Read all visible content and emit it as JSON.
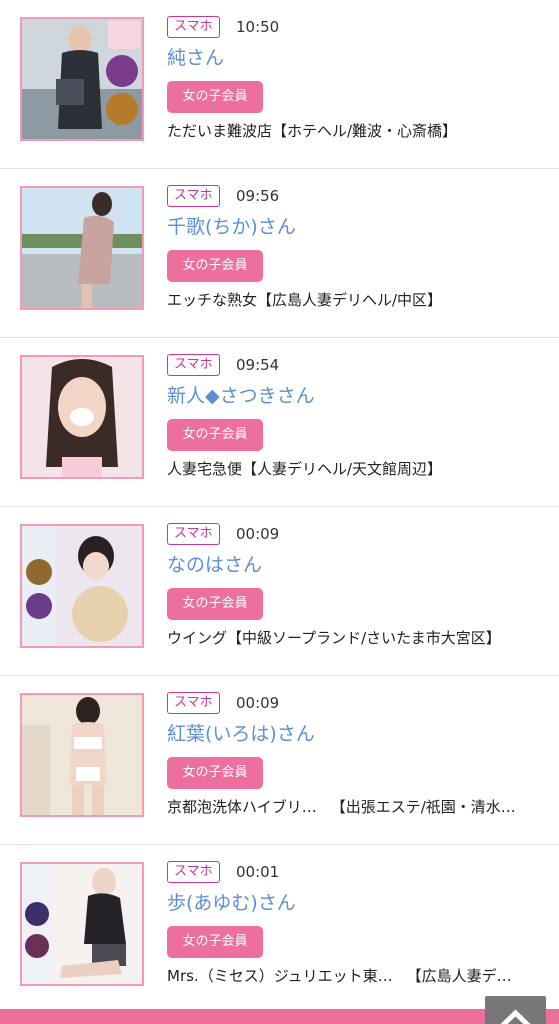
{
  "entries": [
    {
      "device": "スマホ",
      "time": "10:50",
      "name": "純さん",
      "badge": "女の子会員",
      "shop": "ただいま難波店【ホテヘル/難波・心斎橋】",
      "shop_extra": ""
    },
    {
      "device": "スマホ",
      "time": "09:56",
      "name": "千歌(ちか)さん",
      "badge": "女の子会員",
      "shop": "エッチな熟女【広島人妻デリヘル/中区】",
      "shop_extra": ""
    },
    {
      "device": "スマホ",
      "time": "09:54",
      "name": "新人◆さつきさん",
      "badge": "女の子会員",
      "shop": "人妻宅急便【人妻デリヘル/天文館周辺】",
      "shop_extra": ""
    },
    {
      "device": "スマホ",
      "time": "00:09",
      "name": "なのはさん",
      "badge": "女の子会員",
      "shop": "ウイング【中級ソープランド/さいたま市大宮区】",
      "shop_extra": ""
    },
    {
      "device": "スマホ",
      "time": "00:09",
      "name": "紅葉(いろは)さん",
      "badge": "女の子会員",
      "shop": "京都泡洗体ハイブリ…",
      "shop_extra": "【出張エステ/祇園・清水…"
    },
    {
      "device": "スマホ",
      "time": "00:01",
      "name": "歩(あゆむ)さん",
      "badge": "女の子会員",
      "shop": "Mrs.（ミセス）ジュリエット東…",
      "shop_extra": "【広島人妻デ…"
    }
  ],
  "date_bar": {
    "label": ""
  },
  "back_to_top": {
    "icon": "chevron-up-icon"
  },
  "colors": {
    "accent_pink": "#ec6f9d",
    "name_blue": "#5c8fd6",
    "tag_magenta": "#c8379b",
    "thumb_border": "#f29ab8"
  }
}
